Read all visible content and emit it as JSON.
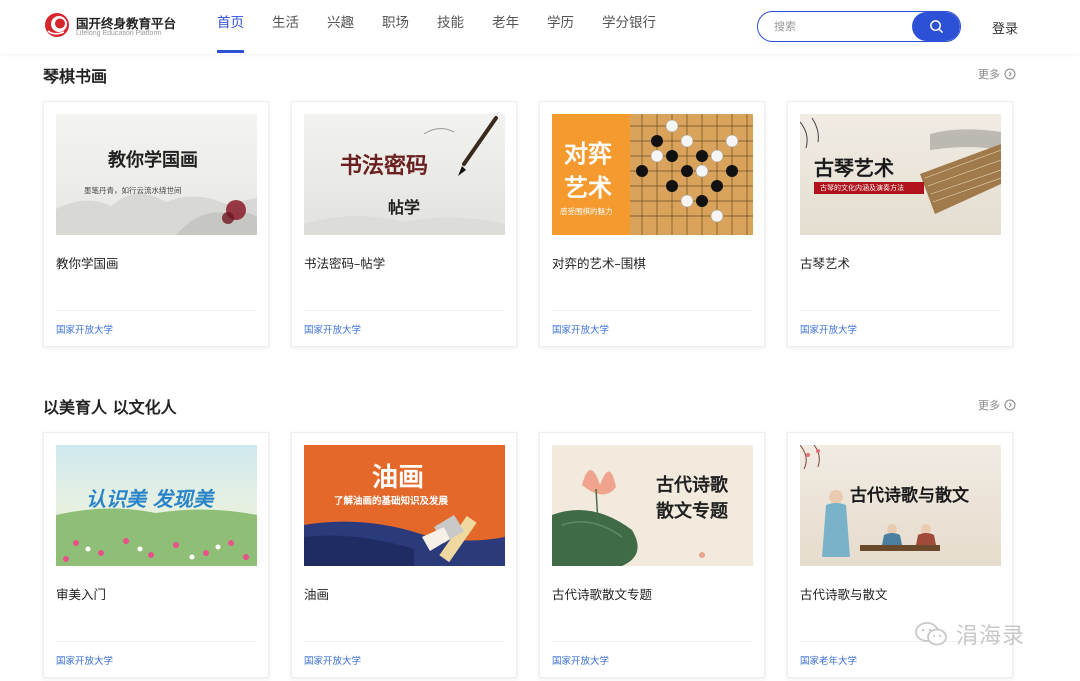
{
  "header": {
    "logo_title": "国开终身教育平台",
    "logo_subtitle": "Lifelong Education Platform",
    "nav": [
      "首页",
      "生活",
      "兴趣",
      "职场",
      "技能",
      "老年",
      "学历",
      "学分银行"
    ],
    "active_nav": "首页",
    "search_placeholder": "搜索",
    "login_label": "登录",
    "accent_color": "#2c50d6"
  },
  "sections": [
    {
      "title": "琴棋书画",
      "more_label": "更多",
      "cards": [
        {
          "title": "教你学国画",
          "school": "国家开放大学",
          "thumb_text": "教你学国画",
          "thumb_sub": "墨笔丹青，如行云流水绕世间"
        },
        {
          "title": "书法密码–帖学",
          "school": "国家开放大学",
          "thumb_text": "书法密码",
          "thumb_sub": "帖学"
        },
        {
          "title": "对弈的艺术–围棋",
          "school": "国家开放大学",
          "thumb_text": "对弈",
          "thumb_text2": "艺术",
          "thumb_sub": "感受围棋的魅力"
        },
        {
          "title": "古琴艺术",
          "school": "国家开放大学",
          "thumb_text": "古琴艺术",
          "thumb_sub": "古琴的文化内涵及演奏方法"
        }
      ]
    },
    {
      "title": "以美育人 以文化人",
      "more_label": "更多",
      "cards": [
        {
          "title": "审美入门",
          "school": "国家开放大学",
          "thumb_text": "认识美 发现美"
        },
        {
          "title": "油画",
          "school": "国家开放大学",
          "thumb_text": "油画",
          "thumb_sub": "了解油画的基础知识及发展"
        },
        {
          "title": "古代诗歌散文专题",
          "school": "国家开放大学",
          "thumb_text": "古代诗歌",
          "thumb_text2": "散文专题"
        },
        {
          "title": "古代诗歌与散文",
          "school": "国家老年大学",
          "thumb_text": "古代诗歌与散文"
        }
      ]
    }
  ],
  "watermark": "涓海录"
}
